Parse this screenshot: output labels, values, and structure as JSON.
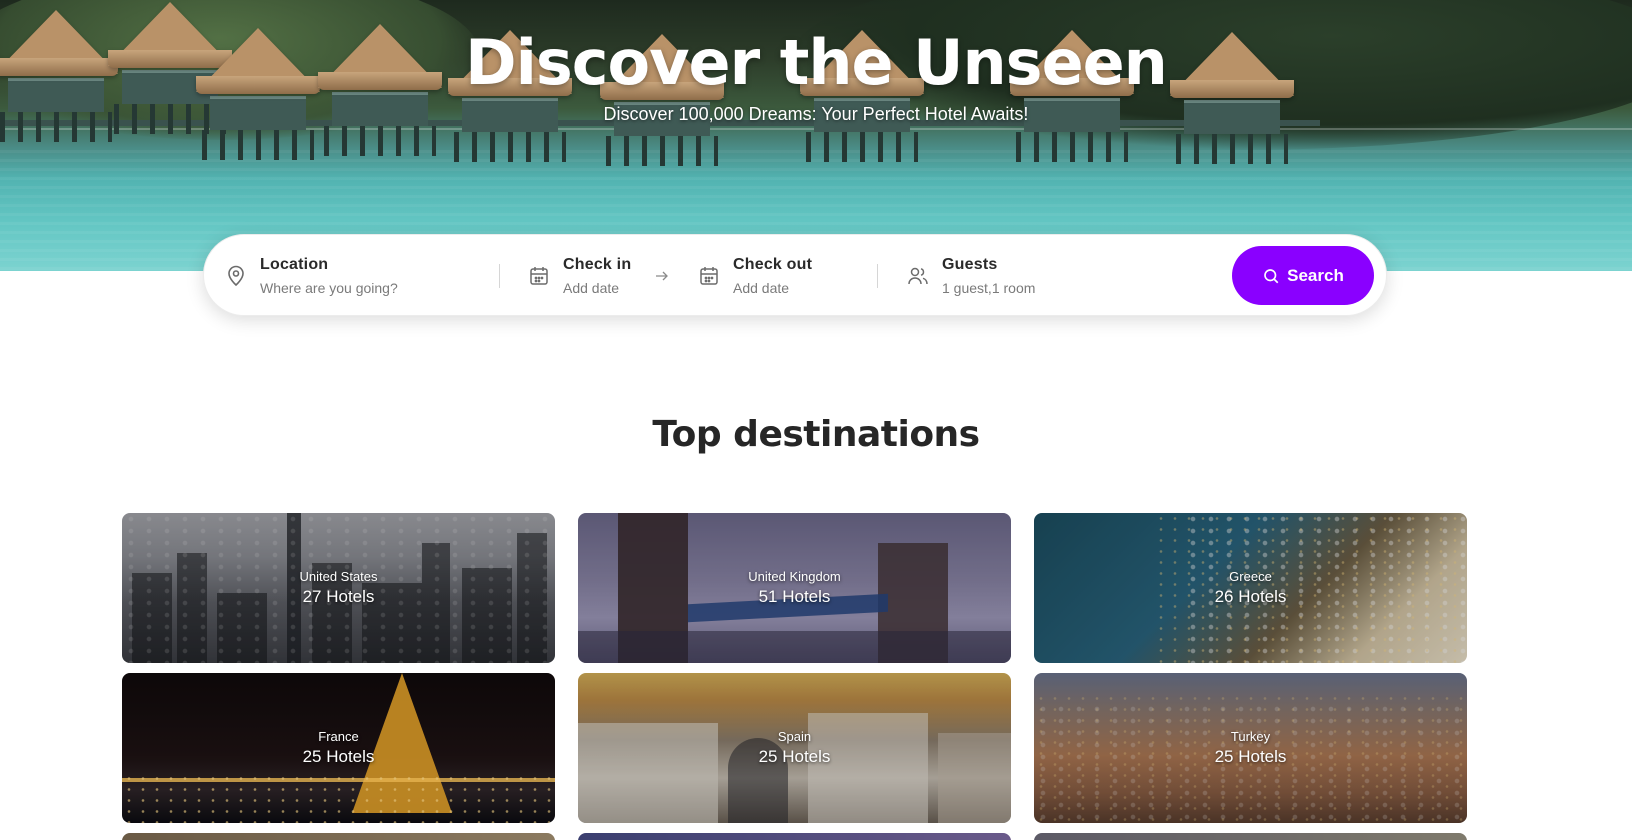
{
  "hero": {
    "title": "Discover the Unseen",
    "subtitle": "Discover 100,000 Dreams: Your Perfect Hotel Awaits!"
  },
  "search": {
    "location": {
      "label": "Location",
      "placeholder": "Where are you going?",
      "icon": "map-pin-icon"
    },
    "check_in": {
      "label": "Check in",
      "value": "Add date",
      "icon": "calendar-icon"
    },
    "check_out": {
      "label": "Check out",
      "value": "Add date",
      "icon": "calendar-icon"
    },
    "guests": {
      "label": "Guests",
      "value": "1 guest,1 room",
      "icon": "users-icon"
    },
    "button_label": "Search",
    "accent_color": "#8a00ff"
  },
  "destinations": {
    "title": "Top destinations",
    "items": [
      {
        "name": "United States",
        "count": "27 Hotels"
      },
      {
        "name": "United Kingdom",
        "count": "51 Hotels"
      },
      {
        "name": "Greece",
        "count": "26 Hotels"
      },
      {
        "name": "France",
        "count": "25 Hotels"
      },
      {
        "name": "Spain",
        "count": "25 Hotels"
      },
      {
        "name": "Turkey",
        "count": "25 Hotels"
      }
    ]
  }
}
